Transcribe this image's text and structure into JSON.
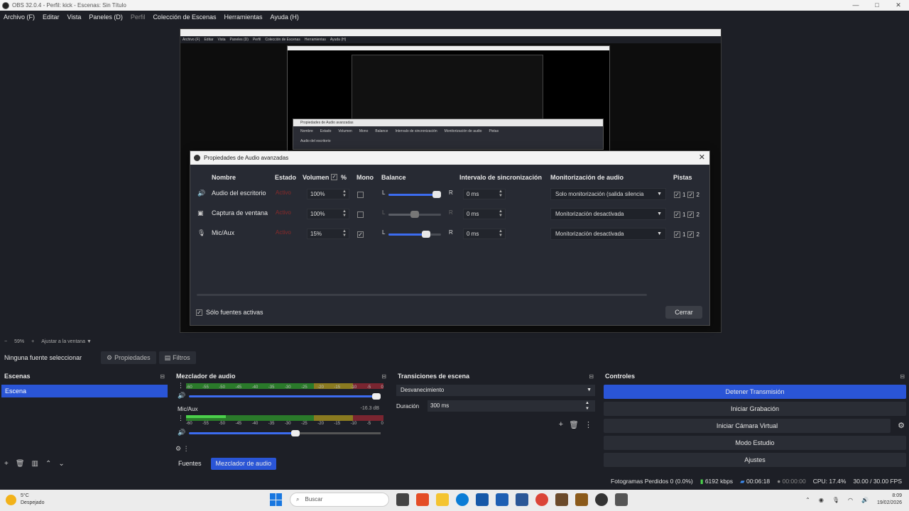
{
  "window": {
    "title": "OBS 32.0.4 - Perfil: kick - Escenas: Sin Título",
    "controls": [
      "—",
      "□",
      "✕"
    ]
  },
  "menu": [
    {
      "label": "Archivo (F)",
      "dim": false
    },
    {
      "label": "Editar",
      "dim": false
    },
    {
      "label": "Vista",
      "dim": false
    },
    {
      "label": "Paneles (D)",
      "dim": false
    },
    {
      "label": "Perfil",
      "dim": true
    },
    {
      "label": "Colección de Escenas",
      "dim": false
    },
    {
      "label": "Herramientas",
      "dim": false
    },
    {
      "label": "Ayuda (H)",
      "dim": false
    }
  ],
  "nested_dialog": {
    "title": "Propiedades de Audio avanzadas",
    "row_name": "Audio del escritorio"
  },
  "dialog": {
    "title": "Propiedades de Audio avanzadas",
    "close": "✕",
    "headers": {
      "name": "Nombre",
      "state": "Estado",
      "volume": "Volumen",
      "percent": "%",
      "mono": "Mono",
      "balance": "Balance",
      "sync": "Intervalo de sincronización",
      "monitoring": "Monitorización de audio",
      "tracks": "Pistas"
    },
    "rows": [
      {
        "icon": "speaker-icon",
        "glyph": "🔊",
        "name": "Audio del escritorio",
        "state": "Activo",
        "volume": "100%",
        "mono": false,
        "balance_l": "L",
        "balance_r": "R",
        "balance_value": 1.0,
        "balance_active": true,
        "sync": "0 ms",
        "monitoring": "Solo monitorización (salida silencia",
        "track1": "1",
        "track2": "2"
      },
      {
        "icon": "window-capture-icon",
        "glyph": "▣",
        "name": "Captura de ventana",
        "state": "Activo",
        "volume": "100%",
        "mono": false,
        "balance_l": "L",
        "balance_r": "R",
        "balance_value": 0.5,
        "balance_active": false,
        "sync": "0 ms",
        "monitoring": "Monitorización desactivada",
        "track1": "1",
        "track2": "2"
      },
      {
        "icon": "microphone-icon",
        "glyph": "🎙",
        "name": "Mic/Aux",
        "state": "Activo",
        "volume": "15%",
        "mono": true,
        "balance_l": "L",
        "balance_r": "R",
        "balance_value": 0.75,
        "balance_active": true,
        "sync": "0 ms",
        "monitoring": "Monitorización desactivada",
        "track1": "1",
        "track2": "2"
      }
    ],
    "only_active_label": "Sólo fuentes activas",
    "close_button": "Cerrar"
  },
  "zoombar": {
    "minus": "−",
    "zoom": "59%",
    "plus": "+",
    "fit": "Ajustar a la ventana"
  },
  "source_bar": {
    "no_source": "Ninguna fuente seleccionar",
    "properties": "Propiedades",
    "filters": "Filtros"
  },
  "scenes": {
    "title": "Escenas",
    "items": [
      "Escena"
    ]
  },
  "mixer": {
    "title": "Mezclador de audio",
    "ticks": [
      "-60",
      "-55",
      "-50",
      "-45",
      "-40",
      "-35",
      "-30",
      "-25",
      "-20",
      "-15",
      "-10",
      "-5",
      "0"
    ],
    "channels": [
      {
        "name": "",
        "db": "",
        "level": 0.0,
        "volume": 1.0
      },
      {
        "name": "Mic/Aux",
        "db": "-16.3 dB",
        "level": 0.2,
        "volume": 0.56
      }
    ],
    "tabs": [
      "Fuentes",
      "Mezclador de audio"
    ],
    "active_tab": 1
  },
  "transitions": {
    "title": "Transiciones de escena",
    "selected": "Desvanecimiento",
    "duration_label": "Duración",
    "duration": "300 ms"
  },
  "controls": {
    "title": "Controles",
    "buttons": [
      "Detener Transmisión",
      "Iniciar Grabación",
      "Iniciar Cámara Virtual",
      "Modo Estudio",
      "Ajustes"
    ]
  },
  "status": {
    "dropped": "Fotogramas Perdidos 0 (0.0%)",
    "bitrate": "6192 kbps",
    "stream_time": "00:06:18",
    "rec_time": "00:00:00",
    "cpu": "CPU: 17.4%",
    "fps": "30.00 / 30.00 FPS"
  },
  "taskbar": {
    "temp": "5°C",
    "weather": "Despejado",
    "search": "Buscar",
    "time": "8:09",
    "date": "19/02/2026"
  },
  "colors": {
    "accent": "#2a55d6",
    "active_state": "#8b2a2a"
  }
}
